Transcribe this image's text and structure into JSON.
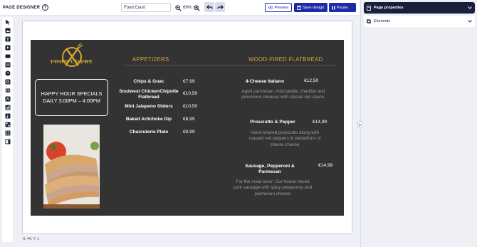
{
  "app": {
    "title": "PAGE DESIGNER",
    "help_glyph": "?"
  },
  "toolbar_top": {
    "page_name": "Food Court",
    "zoom_level": "69%",
    "preview_label": "Preview",
    "save_label": "Save design",
    "pause_label": "Pause"
  },
  "right_panel": {
    "page_properties_label": "Page properties",
    "elements_label": "Elements"
  },
  "status": {
    "cursor_position": "X: 44, Y: 1"
  },
  "board": {
    "logo_text": "FOOD COURT",
    "happy_hour_line1": "HAPPY HOUR SPECIALS",
    "happy_hour_line2": "DAILY 3:00PM – 4:00PM",
    "appetizers_title": "APPETIZERS",
    "flatbread_title": "WOOD-FIRED FLATBREAD",
    "appetizers": [
      {
        "name": "Chips & Guac",
        "price": "€7,99"
      },
      {
        "name": "Soutwest ChickenChipotle Flatbread",
        "price": "€10,50"
      },
      {
        "name": "Mini Jalapeno Sliders",
        "price": "€10,50"
      },
      {
        "name": "Baked Artichoke Dip",
        "price": "€8,99"
      },
      {
        "name": "Charcuterie Plate",
        "price": "€9,99"
      }
    ],
    "flatbreads": [
      {
        "name": "4-Cheese Italiano",
        "price": "€12,50",
        "desc": "Aged parmesan, mozzarella, cheddar and provolone cheeses with classic red sauce."
      },
      {
        "name": "Prosciutto & Pepper",
        "price": "€14,99",
        "desc": "Hand-shaved prosciutto along with roasted red peppers & medallions of chevre cheese"
      },
      {
        "name": "Sausage, Pepperoni & Parmesan",
        "price": "€14,99",
        "desc": "For the meat-lover: Our house-mixed pork sausage with spicy pepperony and parmesan cheese"
      }
    ]
  },
  "colors": {
    "accent": "#1f2aa8",
    "dark_nav": "#1a1f3a",
    "board_bg": "#333333",
    "gold": "#d7a532"
  }
}
